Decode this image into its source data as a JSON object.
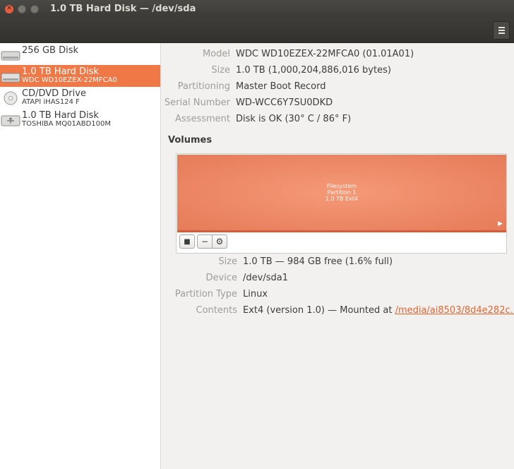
{
  "window": {
    "title": "1.0 TB Hard Disk — /dev/sda"
  },
  "toolbar": {
    "menu_icon": "hamburger-menu-icon"
  },
  "sidebar": {
    "drives": [
      {
        "name": "256 GB Disk",
        "sub": "",
        "icon": "hard-disk-icon",
        "selected": false
      },
      {
        "name": "1.0 TB Hard Disk",
        "sub": "WDC WD10EZEX-22MFCA0",
        "icon": "hard-disk-icon",
        "selected": true
      },
      {
        "name": "CD/DVD Drive",
        "sub": "ATAPI  iHAS124  F",
        "icon": "optical-disc-icon",
        "selected": false
      },
      {
        "name": "1.0 TB Hard Disk",
        "sub": "TOSHIBA MQ01ABD100M",
        "icon": "usb-disk-icon",
        "selected": false
      }
    ]
  },
  "disk": {
    "model_label": "Model",
    "model": "WDC WD10EZEX-22MFCA0 (01.01A01)",
    "size_label": "Size",
    "size": "1.0 TB (1,000,204,886,016 bytes)",
    "partitioning_label": "Partitioning",
    "partitioning": "Master Boot Record",
    "serial_label": "Serial Number",
    "serial": "WD-WCC6Y7SU0DKD",
    "assessment_label": "Assessment",
    "assessment": "Disk is OK (30° C / 86° F)"
  },
  "volumes": {
    "title": "Volumes",
    "partition_line1": "Filesystem",
    "partition_line2": "Partition 1",
    "partition_line3": "1.0 TB Ext4",
    "tools": {
      "stop": "■",
      "remove": "−",
      "settings": "⚙"
    }
  },
  "partition": {
    "size_label": "Size",
    "size": "1.0 TB — 984 GB free (1.6% full)",
    "device_label": "Device",
    "device": "/dev/sda1",
    "type_label": "Partition Type",
    "type": "Linux",
    "contents_label": "Contents",
    "contents_prefix": "Ext4 (version 1.0) — Mounted at ",
    "mount_link": "/media/ai8503/8d4e282c…"
  },
  "colors": {
    "accent": "#f07746",
    "partition": "#ea8260",
    "link": "#e7642f"
  }
}
